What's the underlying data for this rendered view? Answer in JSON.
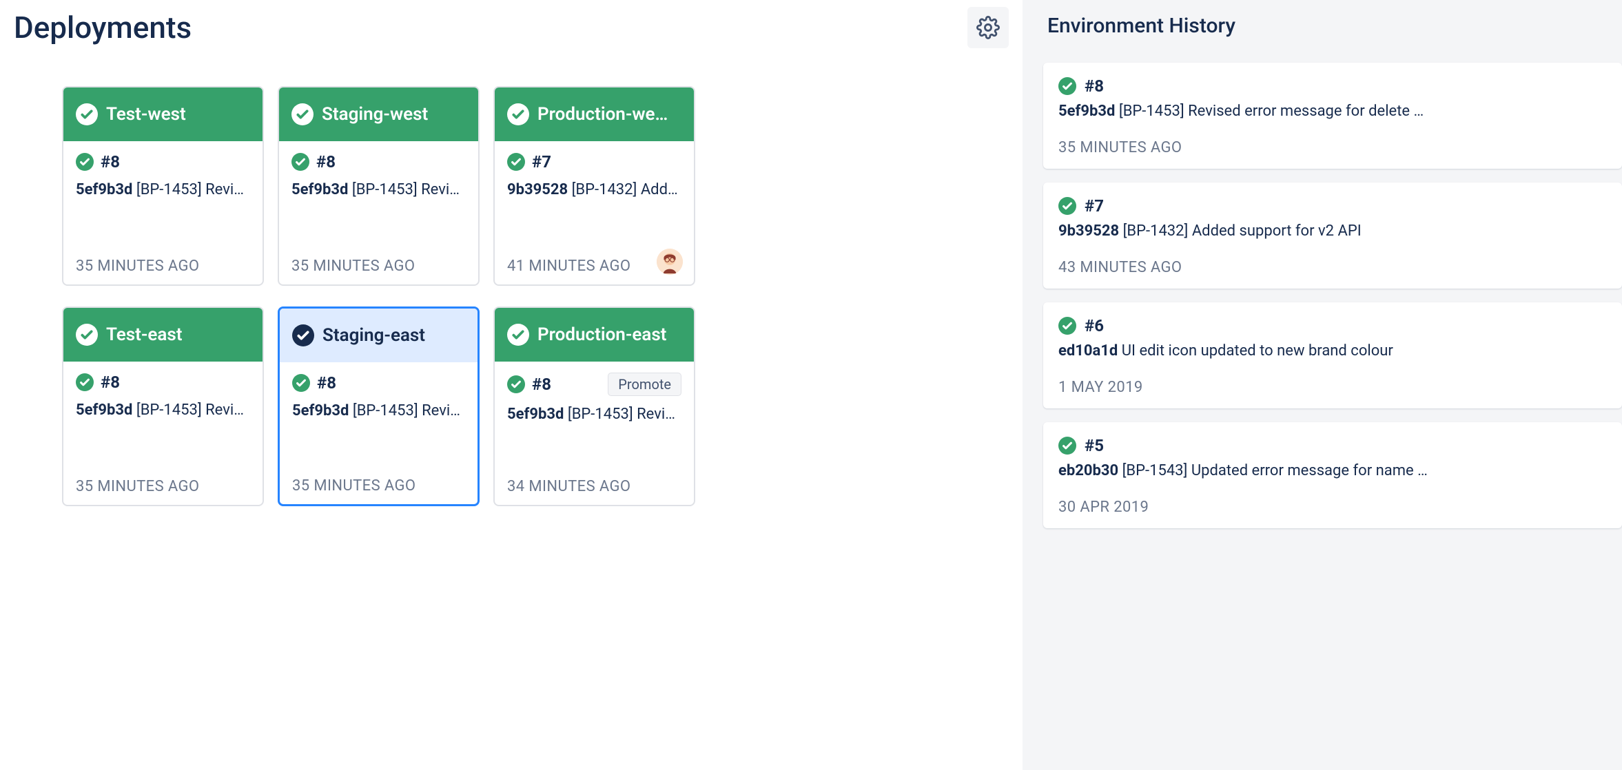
{
  "title": "Deployments",
  "settings_icon": "gear-icon",
  "environments": [
    {
      "id": "test-west",
      "name": "Test-west",
      "selected": false,
      "header_icon": "check-white",
      "build": "#8",
      "commit_hash": "5ef9b3d",
      "commit_msg": "[BP-1453] Revis…",
      "timestamp": "35 MINUTES AGO",
      "avatar": false,
      "promote": false
    },
    {
      "id": "staging-west",
      "name": "Staging-west",
      "selected": false,
      "header_icon": "check-white",
      "build": "#8",
      "commit_hash": "5ef9b3d",
      "commit_msg": "[BP-1453] Revis…",
      "timestamp": "35 MINUTES AGO",
      "avatar": false,
      "promote": false
    },
    {
      "id": "production-west",
      "name": "Production-we…",
      "selected": false,
      "header_icon": "check-white",
      "build": "#7",
      "commit_hash": "9b39528",
      "commit_msg": "[BP-1432] Adde…",
      "timestamp": "41 MINUTES AGO",
      "avatar": true,
      "promote": false
    },
    {
      "id": "test-east",
      "name": "Test-east",
      "selected": false,
      "header_icon": "check-white",
      "build": "#8",
      "commit_hash": "5ef9b3d",
      "commit_msg": "[BP-1453] Revis…",
      "timestamp": "35 MINUTES AGO",
      "avatar": false,
      "promote": false
    },
    {
      "id": "staging-east",
      "name": "Staging-east",
      "selected": true,
      "header_icon": "check-dark",
      "build": "#8",
      "commit_hash": "5ef9b3d",
      "commit_msg": "[BP-1453] Revis…",
      "timestamp": "35 MINUTES AGO",
      "avatar": false,
      "promote": false
    },
    {
      "id": "production-east",
      "name": "Production-east",
      "selected": false,
      "header_icon": "check-white",
      "build": "#8",
      "commit_hash": "5ef9b3d",
      "commit_msg": "[BP-1453] Revis…",
      "timestamp": "34 MINUTES AGO",
      "avatar": false,
      "promote": true,
      "promote_label": "Promote"
    }
  ],
  "history": {
    "title": "Environment History",
    "items": [
      {
        "build": "#8",
        "commit_hash": "5ef9b3d",
        "commit_msg": "[BP-1453] Revised error message for delete …",
        "timestamp": "35 MINUTES AGO"
      },
      {
        "build": "#7",
        "commit_hash": "9b39528",
        "commit_msg": "[BP-1432] Added support for v2 API",
        "timestamp": "43 MINUTES AGO"
      },
      {
        "build": "#6",
        "commit_hash": "ed10a1d",
        "commit_msg": "UI edit icon updated to new brand colour",
        "timestamp": "1 MAY 2019"
      },
      {
        "build": "#5",
        "commit_hash": "eb20b30",
        "commit_msg": "[BP-1543] Updated error message for name …",
        "timestamp": "30 APR 2019"
      }
    ]
  }
}
